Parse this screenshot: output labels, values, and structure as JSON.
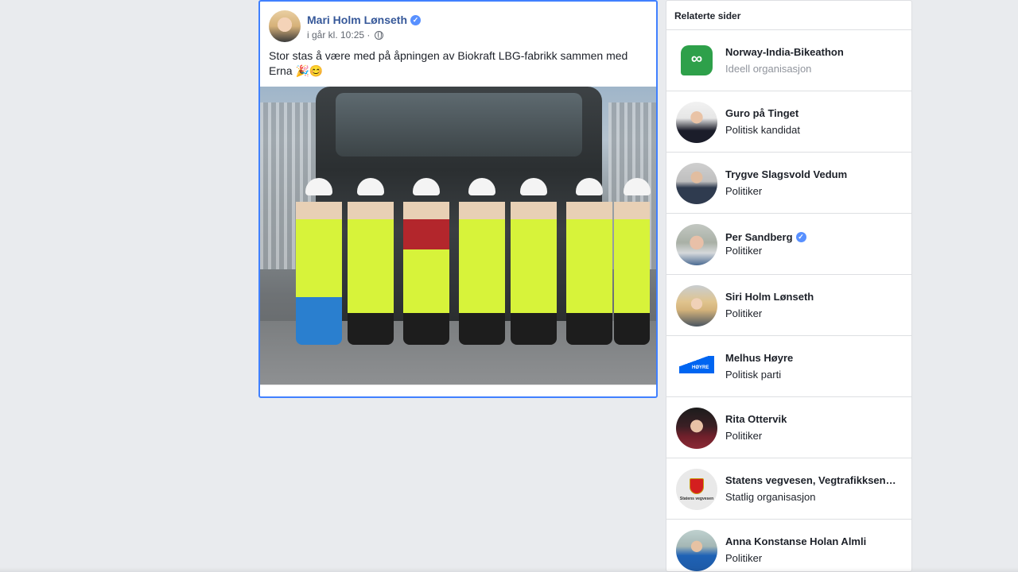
{
  "post": {
    "author": "Mari Holm Lønseth",
    "timestamp": "i går kl. 10:25 ·",
    "visibility_icon": "globe-icon",
    "text": "Stor stas å være med på åpningen av Biokraft LBG-fabrikk sammen med Erna 🎉😊"
  },
  "related": {
    "title": "Relaterte sider",
    "items": [
      {
        "name": "Norway-India-Bikeathon",
        "sub": "Ideell organisasjon",
        "verified": false
      },
      {
        "name": "Guro på Tinget",
        "sub": "Politisk kandidat",
        "verified": false
      },
      {
        "name": "Trygve Slagsvold Vedum",
        "sub": "Politiker",
        "verified": false
      },
      {
        "name": "Per Sandberg",
        "sub": "Politiker",
        "verified": true
      },
      {
        "name": "Siri Holm Lønseth",
        "sub": "Politiker",
        "verified": false
      },
      {
        "name": "Melhus Høyre",
        "sub": "Politisk parti",
        "verified": false
      },
      {
        "name": "Rita Ottervik",
        "sub": "Politiker",
        "verified": false
      },
      {
        "name": "Statens vegvesen, Vegtrafikksentralen",
        "sub": "Statlig organisasjon",
        "verified": false
      },
      {
        "name": "Anna Konstanse Holan Almli",
        "sub": "Politiker",
        "verified": false
      }
    ],
    "logo_text": {
      "hoyre": "HØYRE",
      "vegvesen": "Statens vegvesen"
    }
  },
  "colors": {
    "background": "#e9ebee",
    "link": "#365899",
    "focus_border": "#4080ff",
    "verified": "#5890ff"
  }
}
